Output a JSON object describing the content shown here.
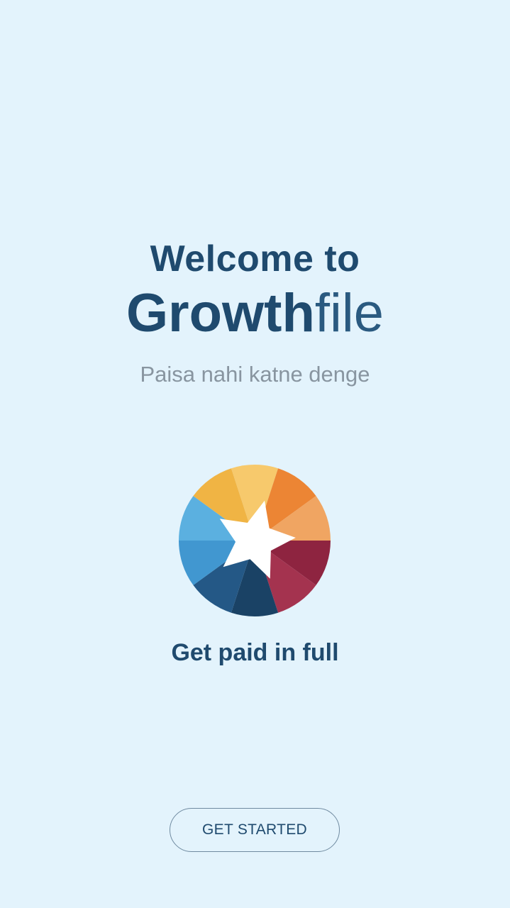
{
  "welcome": {
    "heading": "Welcome to",
    "brand_strong": "Growth",
    "brand_light": "file",
    "tagline": "Paisa nahi katne denge"
  },
  "logo": {
    "icon": "growthfile-star-logo-icon",
    "colors": {
      "background": "#e3f3fc",
      "primary_text": "#1f4a6e",
      "muted_text": "#8895a0",
      "wedge_yellow_dark": "#f0b444",
      "wedge_yellow_light": "#f7c96c",
      "wedge_orange": "#ec8534",
      "wedge_orange_light": "#f0a562",
      "wedge_red_dark": "#8e2440",
      "wedge_red": "#a4334f",
      "wedge_navy": "#1a4265",
      "wedge_blue_dark": "#245886",
      "wedge_blue": "#4197d0",
      "wedge_blue_light": "#5bb0e0",
      "star": "#ffffff"
    }
  },
  "feature": {
    "text": "Get paid in full"
  },
  "actions": {
    "get_started_label": "GET STARTED"
  }
}
